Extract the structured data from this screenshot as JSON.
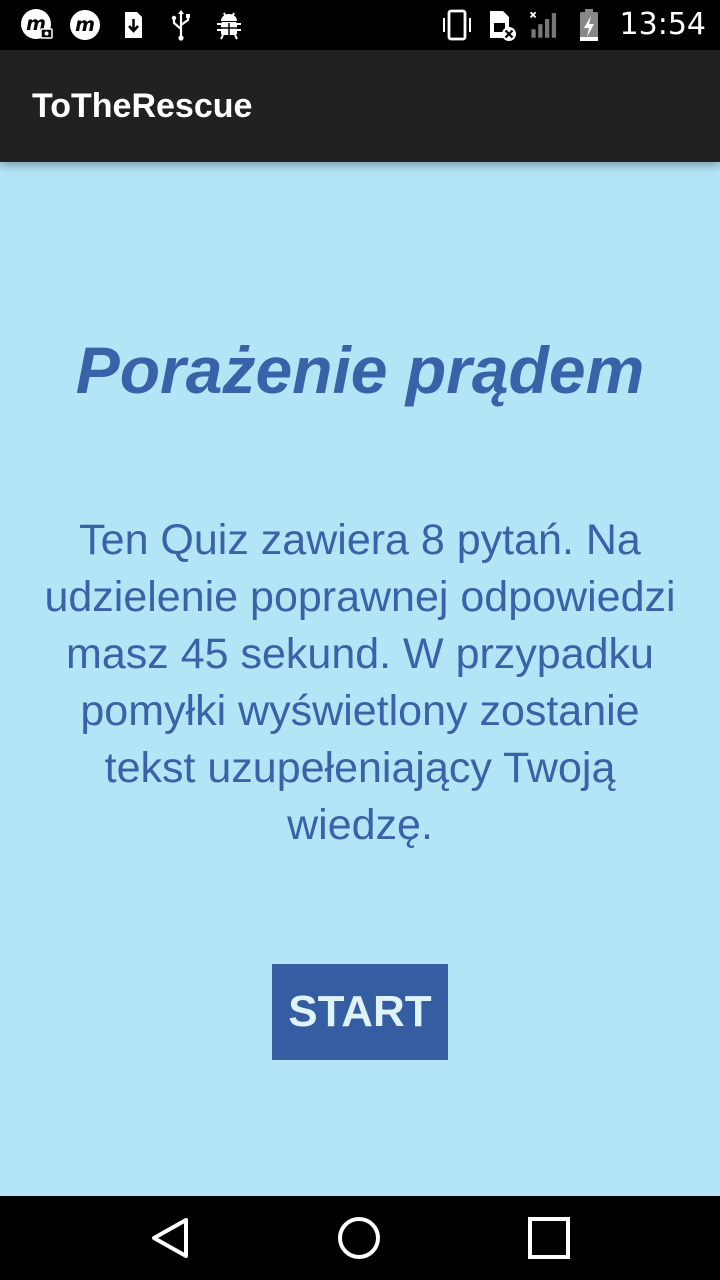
{
  "status_bar": {
    "time": "13:54",
    "left_icons": [
      "m-camera-icon",
      "m-app-icon",
      "sim-download-icon",
      "usb-icon",
      "android-debug-icon"
    ],
    "right_icons": [
      "vibrate-icon",
      "sim-no-service-icon",
      "signal-icon",
      "battery-charging-icon"
    ]
  },
  "app_bar": {
    "title": "ToTheRescue"
  },
  "main": {
    "title": "Porażenie prądem",
    "description": "Ten Quiz zawiera 8 pytań. Na udzielenie poprawnej odpowiedzi masz 45 sekund. W przypadku pomyłki wyświetlony zostanie tekst uzupełeniający Twoją wiedzę.",
    "start_label": "START"
  },
  "nav_bar": {
    "icons": [
      "back-icon",
      "home-icon",
      "recents-icon"
    ]
  },
  "colors": {
    "background": "#b3e5f7",
    "app_bar": "#212121",
    "text_accent": "#3a62a8",
    "button": "#365da1"
  }
}
